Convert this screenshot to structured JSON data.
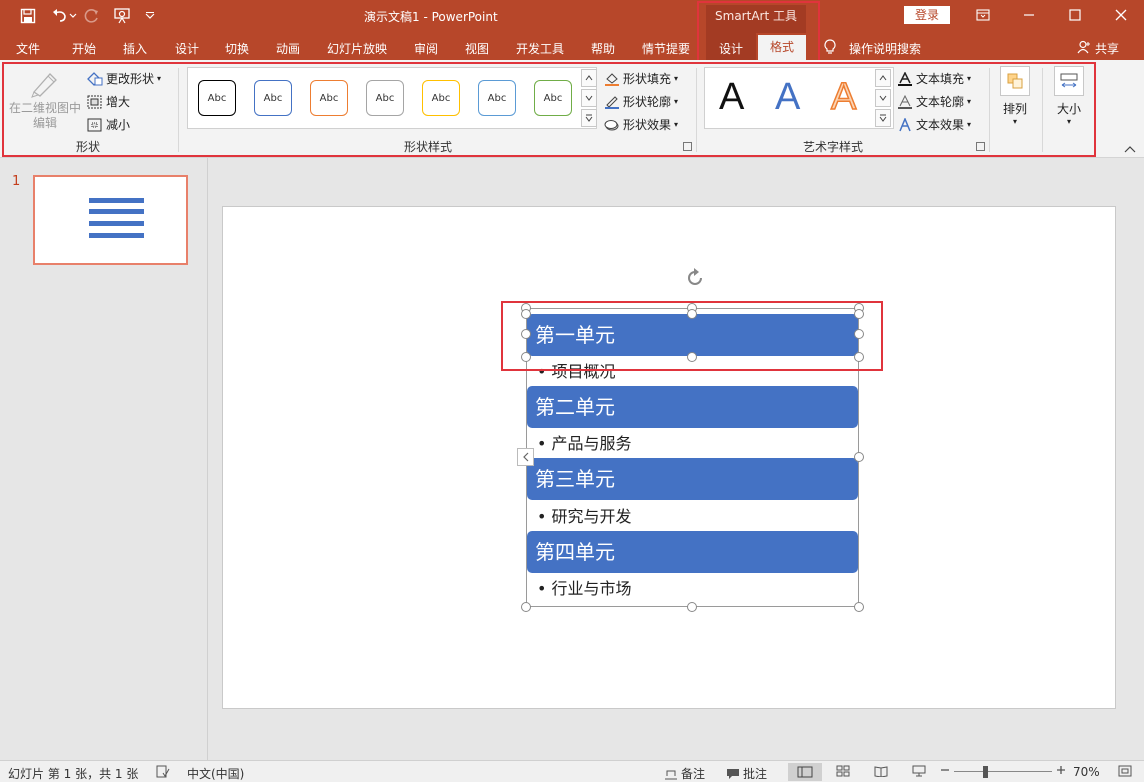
{
  "title_bar": {
    "window_title": "演示文稿1  -  PowerPoint",
    "contextual_header": "SmartArt 工具",
    "login_label": "登录"
  },
  "tabs": {
    "file": "文件",
    "home": "开始",
    "insert": "插入",
    "design": "设计",
    "transitions": "切换",
    "animations": "动画",
    "slideshow": "幻灯片放映",
    "review": "审阅",
    "view": "视图",
    "developer": "开发工具",
    "help": "帮助",
    "storyboard": "情节提要",
    "smartart_design": "设计",
    "smartart_format": "格式",
    "tell_me": "操作说明搜索",
    "share": "共享"
  },
  "ribbon": {
    "shapes_group": {
      "label": "形状",
      "edit_in_2d": "在二维视图中编辑",
      "change_shape": "更改形状",
      "larger": "增大",
      "smaller": "减小"
    },
    "shape_styles_group": {
      "label": "形状样式",
      "thumb_text": "Abc",
      "thumb_colors": [
        "#000000",
        "#4472c4",
        "#ed7d31",
        "#a5a5a5",
        "#ffc000",
        "#5b9bd5",
        "#70ad47"
      ],
      "shape_fill": "形状填充",
      "shape_outline": "形状轮廓",
      "shape_effects": "形状效果"
    },
    "wordart_group": {
      "label": "艺术字样式",
      "letter": "A",
      "text_fill": "文本填充",
      "text_outline": "文本轮廓",
      "text_effects": "文本效果"
    },
    "arrange_label": "排列",
    "size_label": "大小"
  },
  "slide_pane": {
    "slide_number": "1"
  },
  "smartart": {
    "units": [
      {
        "title": "第一单元",
        "bullet": "项目概况"
      },
      {
        "title": "第二单元",
        "bullet": "产品与服务"
      },
      {
        "title": "第三单元",
        "bullet": "研究与开发"
      },
      {
        "title": "第四单元",
        "bullet": "行业与市场"
      }
    ],
    "fill_color": "#4472c4"
  },
  "status_bar": {
    "slide_info": "幻灯片 第 1 张，共 1 张",
    "language": "中文(中国)",
    "notes": "备注",
    "comments": "批注",
    "zoom": "70%"
  },
  "colors": {
    "accent": "#b7472a",
    "highlight_box": "#e0343c"
  }
}
